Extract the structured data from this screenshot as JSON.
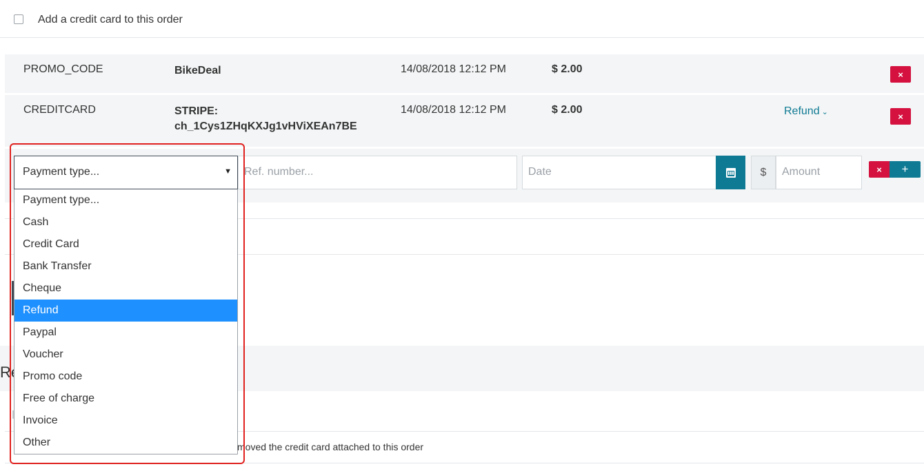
{
  "credit_card": {
    "label": "Add a credit card to this order",
    "checked": false
  },
  "payments": [
    {
      "type": "PROMO_CODE",
      "reference_line1": "BikeDeal",
      "reference_line2": "",
      "date": "14/08/2018 12:12 PM",
      "amount": "$ 2.00",
      "action": ""
    },
    {
      "type": "CREDITCARD",
      "reference_line1": "STRIPE:",
      "reference_line2": "ch_1Cys1ZHqKXJg1vHViXEAn7BE",
      "date": "14/08/2018 12:12 PM",
      "amount": "$ 2.00",
      "action": "Refund"
    }
  ],
  "new_payment": {
    "type_selected": "Payment type...",
    "ref_placeholder": "Ref. number...",
    "date_placeholder": "Date",
    "currency_symbol": "$",
    "amount_placeholder": "Amount",
    "delete_glyph": "×",
    "add_glyph": "+"
  },
  "dropdown": {
    "options": [
      "Payment type...",
      "Cash",
      "Credit Card",
      "Bank Transfer",
      "Cheque",
      "Refund",
      "Paypal",
      "Voucher",
      "Promo code",
      "Free of charge",
      "Invoice",
      "Other"
    ],
    "highlighted": "Refund"
  },
  "background": {
    "heading_fragment": "Re",
    "removed_text": "moved the credit card attached to this order"
  },
  "colors": {
    "accent": "#0f7a94",
    "danger": "#d4113f",
    "row_bg": "#f3f5f6",
    "highlight_option": "#1e90ff",
    "annotation_frame": "#e0201e"
  },
  "icons": {
    "calendar": "calendar-icon",
    "select_caret": "caret-down-icon",
    "refund_chevron": "chevron-down-icon"
  }
}
